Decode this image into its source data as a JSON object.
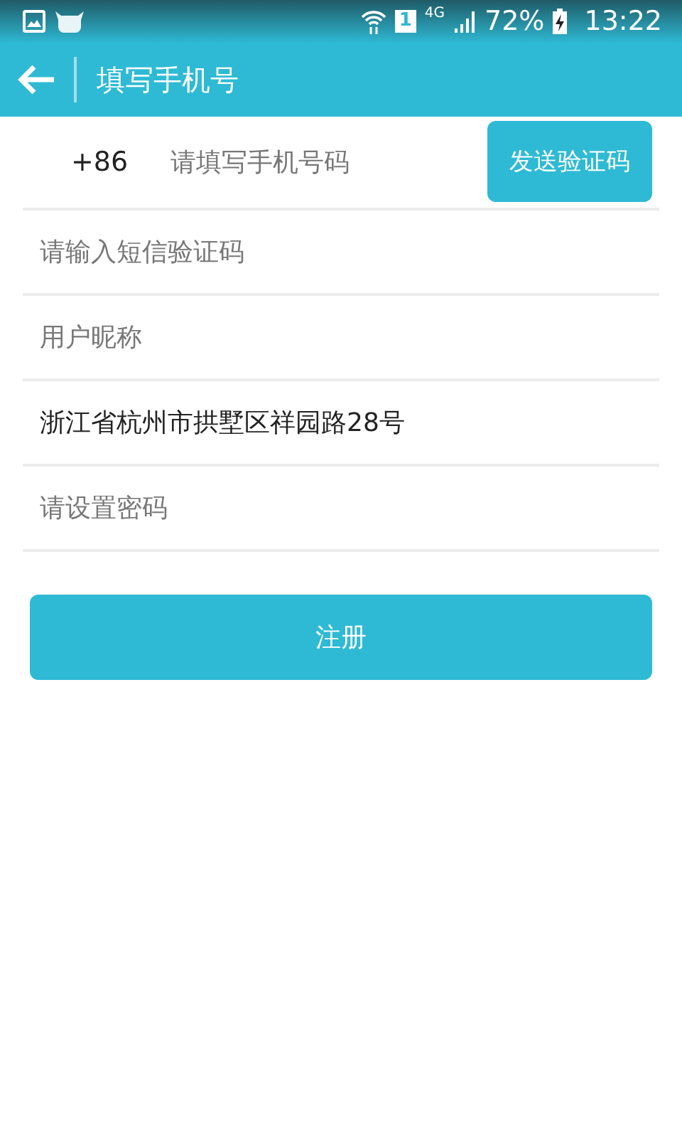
{
  "status_bar": {
    "sim": "1",
    "network": "4G",
    "battery": "72%",
    "time": "13:22"
  },
  "app_bar": {
    "title": "填写手机号"
  },
  "phone": {
    "prefix": "+86",
    "placeholder": "请填写手机号码",
    "button": "发送验证码"
  },
  "fields": [
    {
      "placeholder": "请输入短信验证码"
    },
    {
      "placeholder": "用户昵称"
    },
    {
      "value": "浙江省杭州市拱墅区祥园路28号"
    },
    {
      "placeholder": "请设置密码"
    }
  ],
  "submit": "注册"
}
